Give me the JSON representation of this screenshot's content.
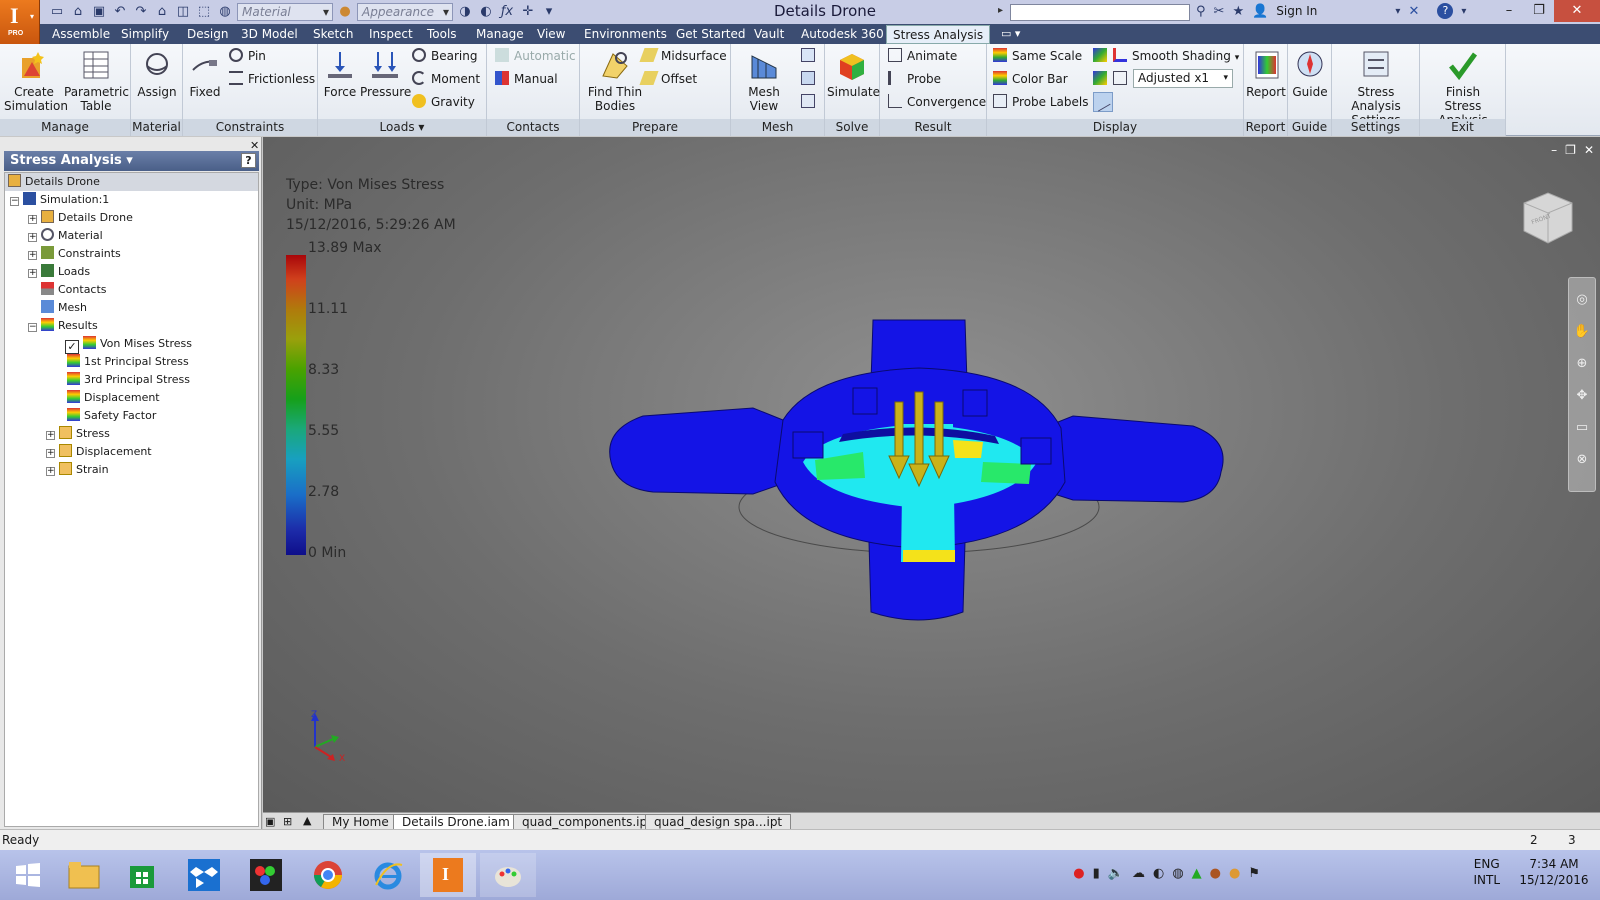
{
  "app": {
    "title": "Details Drone",
    "logo_letter": "I",
    "logo_badge": "PRO"
  },
  "qat": {
    "material_placeholder": "Material",
    "appearance_placeholder": "Appearance",
    "search_placeholder": "",
    "sign_in": "Sign In"
  },
  "ribbon_tabs": [
    {
      "label": "Assemble"
    },
    {
      "label": "Simplify"
    },
    {
      "label": "Design"
    },
    {
      "label": "3D Model"
    },
    {
      "label": "Sketch"
    },
    {
      "label": "Inspect"
    },
    {
      "label": "Tools"
    },
    {
      "label": "Manage"
    },
    {
      "label": "View"
    },
    {
      "label": "Environments"
    },
    {
      "label": "Get Started"
    },
    {
      "label": "Vault"
    },
    {
      "label": "Autodesk 360"
    },
    {
      "label": "Stress Analysis"
    }
  ],
  "ribbon": {
    "manage": {
      "label": "Manage",
      "create_simulation_1": "Create",
      "create_simulation_2": "Simulation",
      "parametric_1": "Parametric",
      "parametric_2": "Table"
    },
    "material": {
      "label": "Material",
      "assign": "Assign"
    },
    "constraints": {
      "label": "Constraints",
      "fixed": "Fixed",
      "pin": "Pin",
      "frictionless": "Frictionless"
    },
    "loads": {
      "label": "Loads",
      "force": "Force",
      "pressure": "Pressure",
      "bearing": "Bearing",
      "moment": "Moment",
      "gravity": "Gravity"
    },
    "contacts": {
      "label": "Contacts",
      "automatic": "Automatic",
      "manual": "Manual"
    },
    "prepare": {
      "label": "Prepare",
      "find_thin_1": "Find Thin",
      "find_thin_2": "Bodies",
      "midsurface": "Midsurface",
      "offset": "Offset"
    },
    "mesh": {
      "label": "Mesh",
      "mesh_view": "Mesh View"
    },
    "solve": {
      "label": "Solve",
      "simulate": "Simulate"
    },
    "result": {
      "label": "Result",
      "animate": "Animate",
      "probe": "Probe",
      "convergence": "Convergence"
    },
    "display": {
      "label": "Display",
      "same_scale": "Same Scale",
      "color_bar": "Color Bar",
      "probe_labels": "Probe Labels",
      "shading": "Smooth Shading",
      "adjusted": "Adjusted x1"
    },
    "report": {
      "label": "Report",
      "report": "Report"
    },
    "guide": {
      "label": "Guide",
      "guide": "Guide"
    },
    "settings": {
      "label": "Settings",
      "sa_settings_1": "Stress Analysis",
      "sa_settings_2": "Settings"
    },
    "exit": {
      "label": "Exit",
      "finish_1": "Finish",
      "finish_2": "Stress Analysis"
    }
  },
  "browser": {
    "header": "Stress Analysis",
    "help": "?",
    "root": "Details Drone",
    "nodes": [
      {
        "label": "Simulation:1"
      },
      {
        "label": "Details Drone"
      },
      {
        "label": "Material"
      },
      {
        "label": "Constraints"
      },
      {
        "label": "Loads"
      },
      {
        "label": "Contacts"
      },
      {
        "label": "Mesh"
      },
      {
        "label": "Results"
      },
      {
        "label": "Von Mises Stress"
      },
      {
        "label": "1st Principal Stress"
      },
      {
        "label": "3rd Principal Stress"
      },
      {
        "label": "Displacement"
      },
      {
        "label": "Safety Factor"
      },
      {
        "label": "Stress"
      },
      {
        "label": "Displacement"
      },
      {
        "label": "Strain"
      }
    ]
  },
  "viewport": {
    "type_line": "Type: Von Mises Stress",
    "unit_line": "Unit: MPa",
    "date_line": "15/12/2016, 5:29:26 AM",
    "color_bar": {
      "ticks": [
        "13.89 Max",
        "11.11",
        "8.33",
        "5.55",
        "2.78",
        "0 Min"
      ]
    },
    "cube_label": "FRONT"
  },
  "doc_tabs": [
    {
      "label": "My Home"
    },
    {
      "label": "Details Drone.iam"
    },
    {
      "label": "quad_components.ipt"
    },
    {
      "label": "quad_design spa...ipt"
    }
  ],
  "status": {
    "text": "Ready",
    "count1": "2",
    "count2": "3"
  },
  "tray": {
    "lang1": "ENG",
    "lang2": "INTL",
    "time": "7:34 AM",
    "date": "15/12/2016"
  },
  "colors": {
    "ribbon_tab_bar": "#3c4d72",
    "active_tab": "#e6eef8",
    "model_blue": "#1414e6",
    "stress_cyan": "#20e8f0",
    "load_arrows": "#c9b21a"
  }
}
